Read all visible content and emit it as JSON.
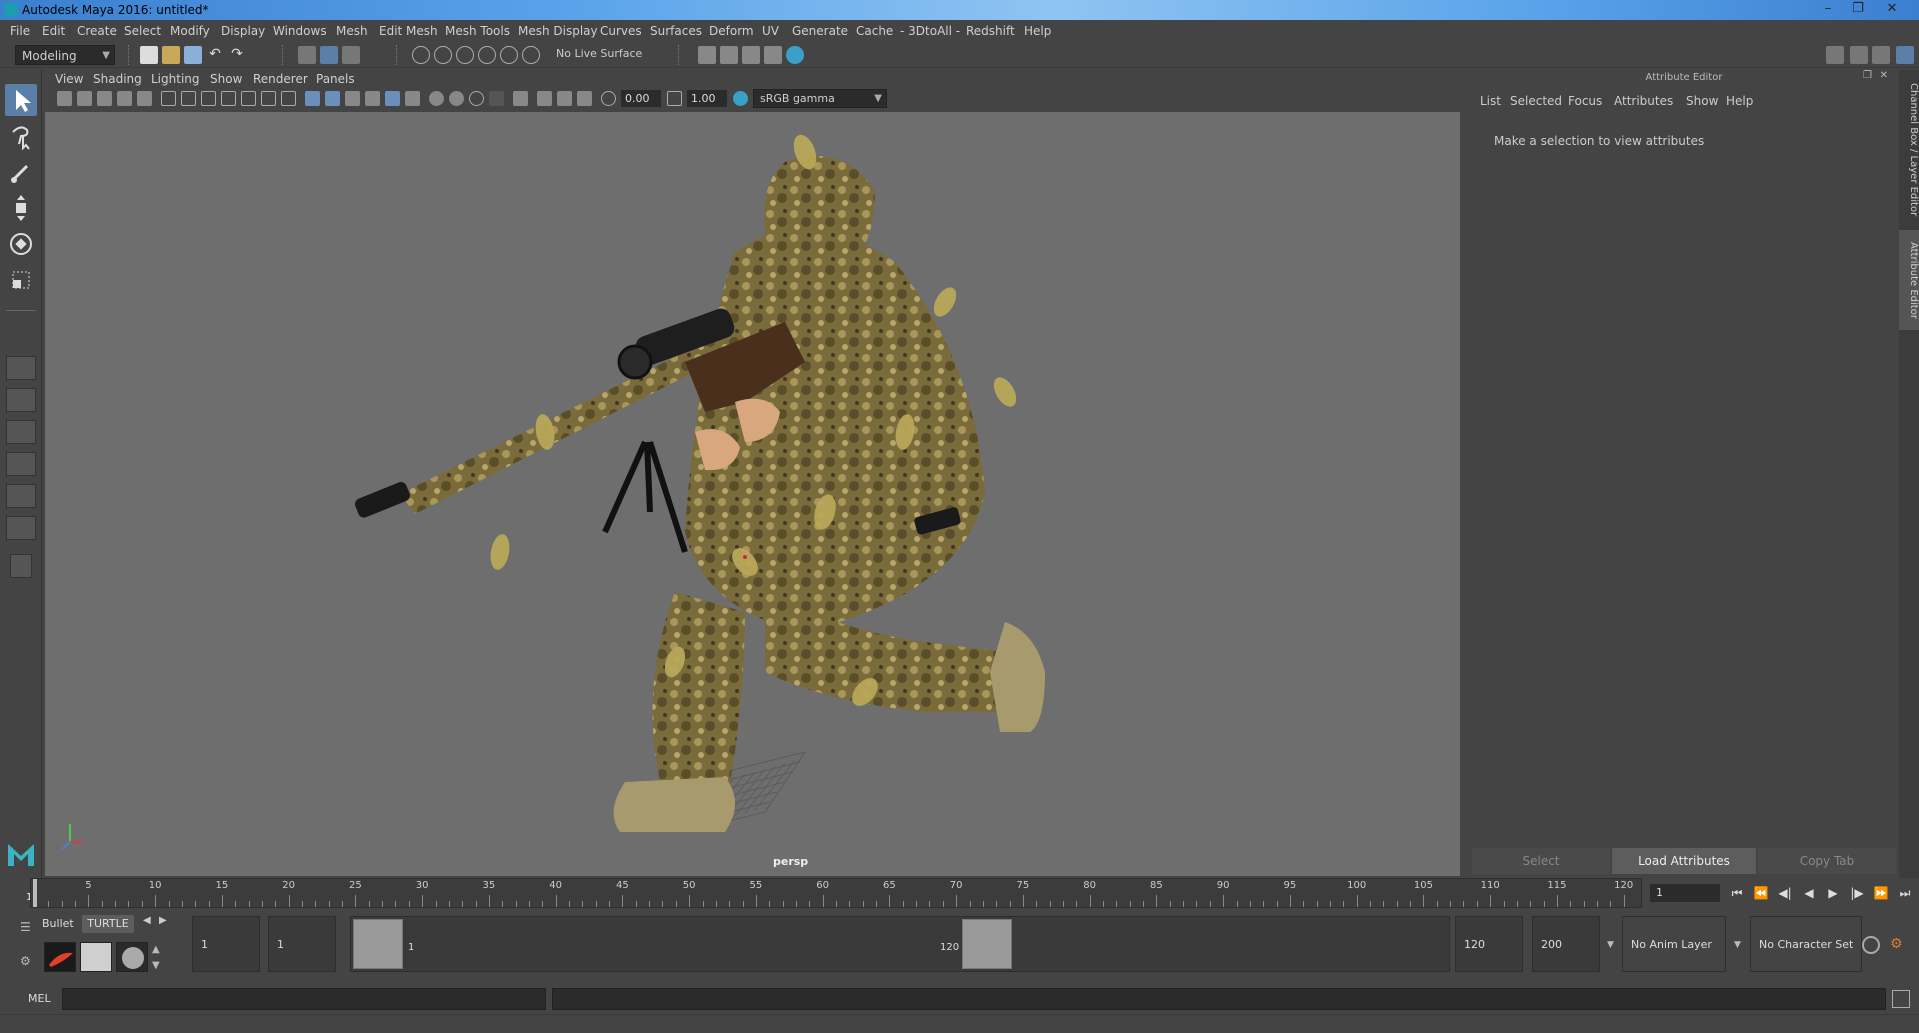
{
  "window": {
    "title": "Autodesk Maya 2016: untitled*",
    "minimize": "–",
    "maximize": "❐",
    "close": "✕"
  },
  "menus": [
    "File",
    "Edit",
    "Create",
    "Select",
    "Modify",
    "Display",
    "Windows",
    "Mesh",
    "Edit Mesh",
    "Mesh Tools",
    "Mesh Display",
    "Curves",
    "Surfaces",
    "Deform",
    "UV",
    "Generate",
    "Cache",
    "- 3DtoAll -",
    "Redshift",
    "Help"
  ],
  "statusline": {
    "menuset": "Modeling",
    "live_surface": "No Live Surface"
  },
  "viewport": {
    "menus": [
      "View",
      "Shading",
      "Lighting",
      "Show",
      "Renderer",
      "Panels"
    ],
    "exposure": "0.00",
    "gamma": "1.00",
    "color_space": "sRGB gamma",
    "camera_label": "persp"
  },
  "attribute_editor": {
    "title": "Attribute Editor",
    "menus": [
      "List",
      "Selected",
      "Focus",
      "Attributes",
      "Show",
      "Help"
    ],
    "message": "Make a selection to view attributes",
    "buttons": {
      "select": "Select",
      "load": "Load Attributes",
      "copy": "Copy Tab"
    }
  },
  "side_tabs": {
    "channel_box": "Channel Box / Layer Editor",
    "attribute_editor": "Attribute Editor"
  },
  "timeslider": {
    "start_label": "1",
    "ticks": [
      "5",
      "10",
      "15",
      "20",
      "25",
      "30",
      "35",
      "40",
      "45",
      "50",
      "55",
      "60",
      "65",
      "70",
      "75",
      "80",
      "85",
      "90",
      "95",
      "100",
      "105",
      "110",
      "115",
      "120"
    ],
    "current_frame": "1"
  },
  "rangeslider": {
    "start_time": "1",
    "playback_start": "1",
    "range_start_label": "1",
    "range_end_label": "120",
    "playback_end": "120",
    "end_time": "200",
    "anim_layer": "No Anim Layer",
    "character_set": "No Character Set"
  },
  "shelf": {
    "tab1": "Bullet",
    "tab2": "TURTLE"
  },
  "cmdline": {
    "label": "MEL"
  }
}
